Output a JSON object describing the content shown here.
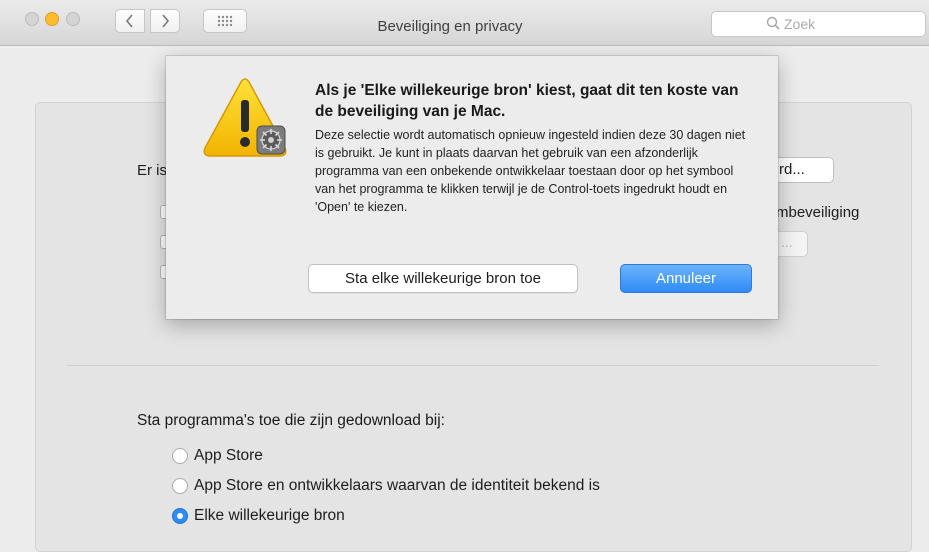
{
  "window": {
    "title": "Beveiliging en privacy",
    "search_placeholder": "Zoek"
  },
  "background": {
    "partial_text_left": "Er is",
    "partial_button": "rd...",
    "partial_text_right": "mbeveiliging",
    "ghost_button": "..."
  },
  "allow": {
    "label": "Sta programma's toe die zijn gedownload bij:",
    "options": [
      {
        "label": "App Store",
        "selected": false
      },
      {
        "label": "App Store en ontwikkelaars waarvan de identiteit bekend is",
        "selected": false
      },
      {
        "label": "Elke willekeurige bron",
        "selected": true
      }
    ]
  },
  "dialog": {
    "title": "Als je 'Elke willekeurige bron' kiest, gaat dit ten koste van de beveiliging van je Mac.",
    "body": "Deze selectie wordt automatisch opnieuw ingesteld indien deze 30 dagen niet is gebruikt. Je kunt in plaats daarvan het gebruik van een afzonderlijk programma van een onbekende ontwikkelaar toestaan door op het symbool van het programma te klikken terwijl je de Control-toets ingedrukt houdt en 'Open' te kiezen.",
    "allow_button": "Sta elke willekeurige bron toe",
    "cancel_button": "Annuleer",
    "icon": "warning-icon"
  },
  "colors": {
    "accent": "#2f8bf5",
    "warning": "#f5c400",
    "minimize": "#fdbc2e"
  }
}
